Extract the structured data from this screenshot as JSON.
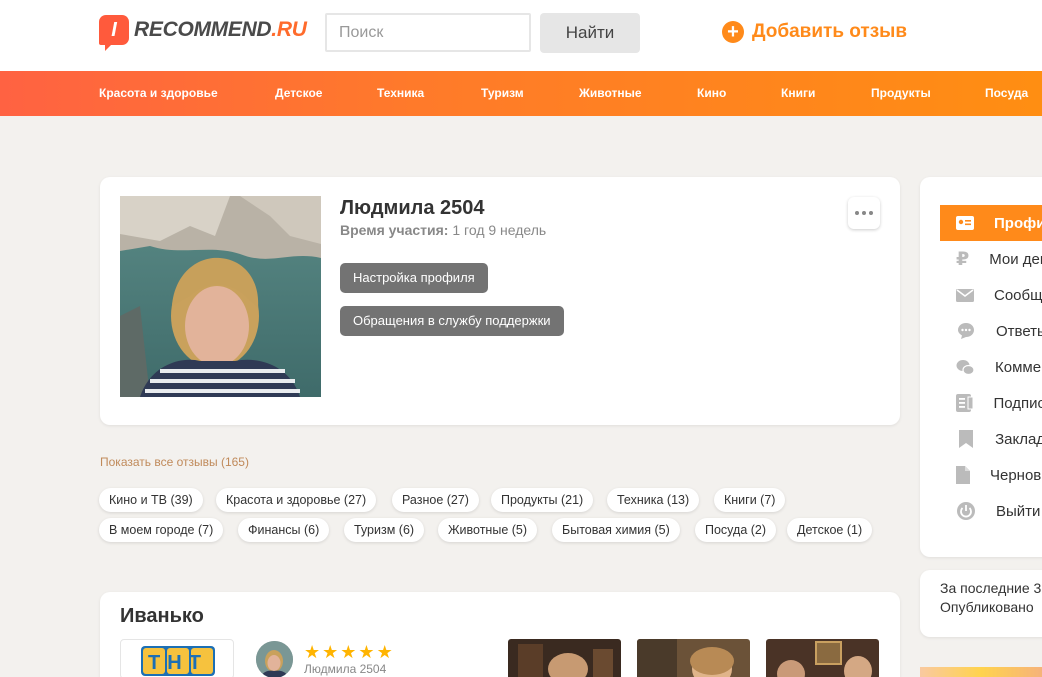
{
  "header": {
    "logo_prefix": "I",
    "logo_main": "RECOMMEND",
    "logo_suffix": ".RU",
    "search_placeholder": "Поиск",
    "search_button": "Найти",
    "add_review": "Добавить отзыв",
    "add_review_icon": "plus-circle-icon",
    "accent_color": "#ff8a1a"
  },
  "nav": {
    "items": [
      "Красота и здоровье",
      "Детское",
      "Техника",
      "Туризм",
      "Животные",
      "Кино",
      "Книги",
      "Продукты",
      "Посуда"
    ]
  },
  "profile": {
    "name": "Людмила 2504",
    "membership_label": "Время участия:",
    "membership_value": "1 год 9 недель",
    "settings_button": "Настройка профиля",
    "support_button": "Обращения в службу поддержки"
  },
  "reviews_summary": {
    "show_all": "Показать все отзывы (165)",
    "tags": [
      "Кино и ТВ (39)",
      "Красота и здоровье (27)",
      "Разное (27)",
      "Продукты (21)",
      "Техника (13)",
      "Книги (7)",
      "В моем городе (7)",
      "Финансы (6)",
      "Туризм (6)",
      "Животные (5)",
      "Бытовая химия (5)",
      "Посуда (2)",
      "Детское (1)"
    ]
  },
  "sidebar": {
    "items": [
      {
        "label": "Профиль",
        "icon": "id-card-icon",
        "active": true
      },
      {
        "label": "Мои деньги",
        "icon": "ruble-icon"
      },
      {
        "label": "Сообщения",
        "icon": "envelope-icon"
      },
      {
        "label": "Ответы",
        "icon": "speech-bubble-icon"
      },
      {
        "label": "Комментарии",
        "icon": "comments-icon"
      },
      {
        "label": "Подписки",
        "icon": "subscriptions-icon"
      },
      {
        "label": "Закладки",
        "icon": "bookmark-icon"
      },
      {
        "label": "Черновики",
        "icon": "document-icon"
      },
      {
        "label": "Выйти",
        "icon": "power-icon"
      }
    ]
  },
  "stats": {
    "line1": "За последние 3",
    "line2": "Опубликовано"
  },
  "review": {
    "title": "Иванько",
    "product_logo": "ТНТ",
    "rating": 5,
    "author": "Людмила 2504"
  }
}
